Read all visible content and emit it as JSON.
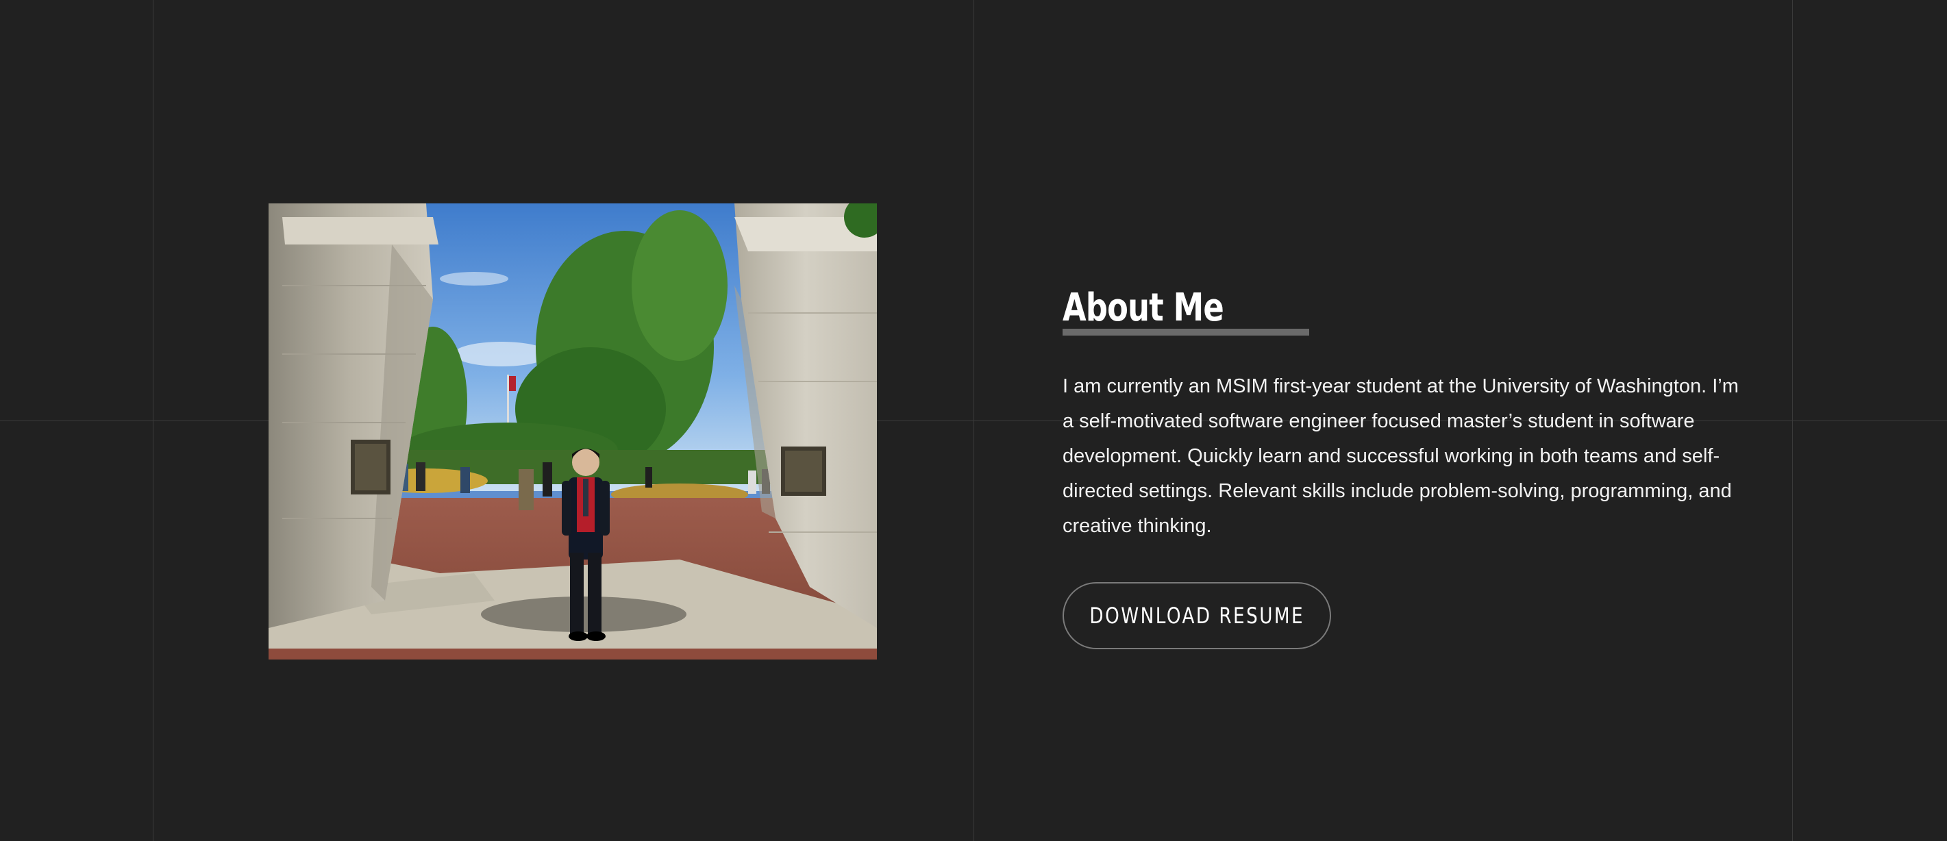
{
  "about": {
    "title": "About Me",
    "bio": "I am currently an MSIM first-year student at the University of Washington. I’m a self-motivated software engineer focused master’s student in software development. Quickly learn and successful working in both teams and self-directed settings. Relevant skills include problem-solving, programming, and creative thinking.",
    "resume_button_label": "DOWNLOAD RESUME"
  },
  "photo": {
    "alt": "Graduate standing between two stone gate pillars on a campus plaza"
  },
  "colors": {
    "background": "#212121",
    "grid_line": "#3a3a3a",
    "title_underline": "#6a6a6a",
    "button_border": "#7a7a7a"
  }
}
